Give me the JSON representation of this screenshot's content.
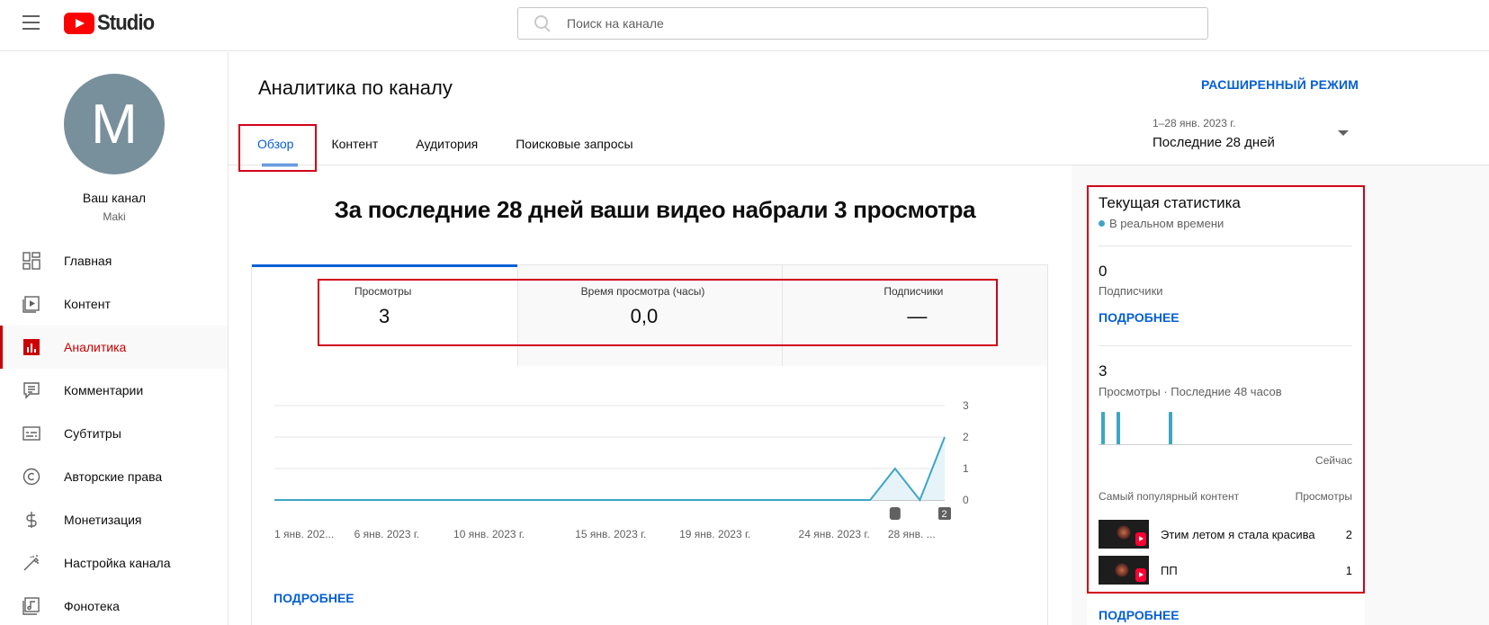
{
  "header": {
    "search_placeholder": "Поиск на канале",
    "logo_text": "Studio"
  },
  "sidebar": {
    "avatar_letter": "M",
    "channel_title": "Ваш канал",
    "channel_name": "Maki",
    "items": [
      {
        "label": "Главная",
        "icon": "dashboard-icon",
        "active": false
      },
      {
        "label": "Контент",
        "icon": "content-icon",
        "active": false
      },
      {
        "label": "Аналитика",
        "icon": "analytics-icon",
        "active": true
      },
      {
        "label": "Комментарии",
        "icon": "comments-icon",
        "active": false
      },
      {
        "label": "Субтитры",
        "icon": "subtitles-icon",
        "active": false
      },
      {
        "label": "Авторские права",
        "icon": "copyright-icon",
        "active": false
      },
      {
        "label": "Монетизация",
        "icon": "monetization-icon",
        "active": false
      },
      {
        "label": "Настройка канала",
        "icon": "customization-icon",
        "active": false
      },
      {
        "label": "Фонотека",
        "icon": "audio-library-icon",
        "active": false
      }
    ]
  },
  "page": {
    "title": "Аналитика по каналу",
    "advanced_mode": "РАСШИРЕННЫЙ РЕЖИМ",
    "tabs": [
      {
        "label": "Обзор",
        "active": true
      },
      {
        "label": "Контент",
        "active": false
      },
      {
        "label": "Аудитория",
        "active": false
      },
      {
        "label": "Поисковые запросы",
        "active": false
      }
    ],
    "date_range_small": "1–28 янв. 2023 г.",
    "date_range_label": "Последние 28 дней"
  },
  "overview": {
    "headline": "За последние 28 дней ваши видео набрали 3 просмотра",
    "metrics": [
      {
        "label": "Просмотры",
        "value": "3"
      },
      {
        "label": "Время просмотра (часы)",
        "value": "0,0"
      },
      {
        "label": "Подписчики",
        "value": "—"
      }
    ],
    "more_label": "ПОДРОБНЕЕ"
  },
  "chart_data": {
    "type": "area",
    "x_ticks": [
      "1 янв. 202...",
      "6 янв. 2023 г.",
      "10 янв. 2023 г.",
      "15 янв. 2023 г.",
      "19 янв. 2023 г.",
      "24 янв. 2023 г.",
      "28 янв. ..."
    ],
    "y_ticks": [
      "3",
      "2",
      "1",
      "0"
    ],
    "ylim": [
      0,
      3
    ],
    "x": [
      1,
      2,
      3,
      4,
      5,
      6,
      7,
      8,
      9,
      10,
      11,
      12,
      13,
      14,
      15,
      16,
      17,
      18,
      19,
      20,
      21,
      22,
      23,
      24,
      25,
      26,
      27,
      28
    ],
    "series": [
      {
        "values": [
          0,
          0,
          0,
          0,
          0,
          0,
          0,
          0,
          0,
          0,
          0,
          0,
          0,
          0,
          0,
          0,
          0,
          0,
          0,
          0,
          0,
          0,
          0,
          0,
          0,
          1,
          0,
          2
        ]
      }
    ],
    "markers": [
      {
        "x": 26,
        "icon": "shorts-icon"
      },
      {
        "x": 28,
        "label": "2"
      }
    ],
    "line_color": "#3ea6c4",
    "fill_color": "#e6f4f9",
    "grid": true
  },
  "realtime": {
    "title": "Текущая статистика",
    "live_label": "В реальном времени",
    "subscribers_value": "0",
    "subscribers_label": "Подписчики",
    "more_label": "ПОДРОБНЕЕ",
    "views_value": "3",
    "views_label": "Просмотры · Последние 48 часов",
    "now_label": "Сейчас",
    "bars": [
      {
        "hour": 1,
        "views": 1
      },
      {
        "hour": 4,
        "views": 1
      },
      {
        "hour": 14,
        "views": 1
      }
    ],
    "hours": 48,
    "popular_header": "Самый популярный контент",
    "views_header": "Просмотры",
    "popular": [
      {
        "title": "Этим летом я стала красива",
        "views": "2"
      },
      {
        "title": "ПП",
        "views": "1"
      }
    ],
    "bottom_more_label": "ПОДРОБНЕЕ"
  },
  "colors": {
    "accent": "#065fd4",
    "active_red": "#cc0000",
    "highlight_box": "#d0021b",
    "chart_line": "#3ea6c4"
  }
}
